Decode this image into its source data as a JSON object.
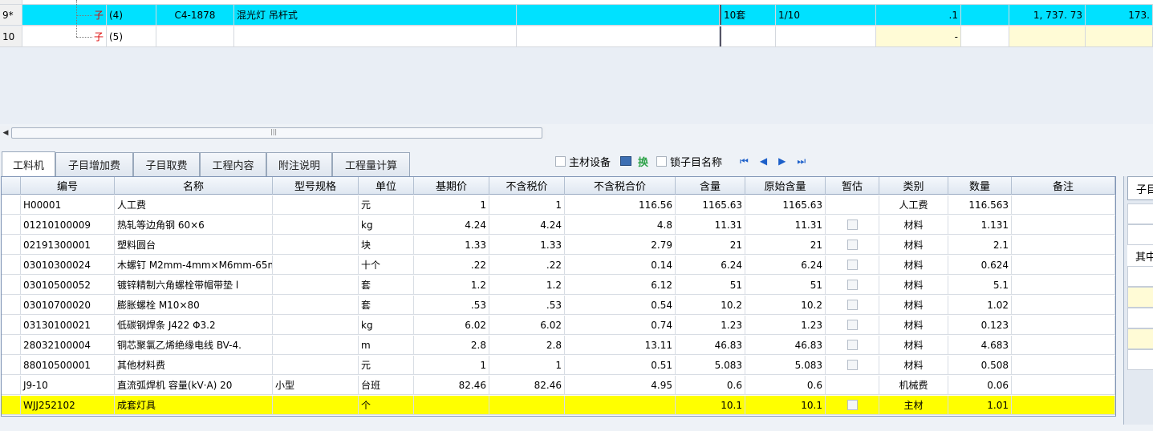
{
  "top": {
    "rows": [
      {
        "num": "9*",
        "type": "子",
        "code_seq": "(4)",
        "code": "C4-1878",
        "name": "混光灯 吊杆式",
        "unit": "10套",
        "qty": "1/10",
        "amt": ".1",
        "price": "1, 737. 73",
        "total": "173."
      },
      {
        "num": "10",
        "type": "子",
        "code_seq": "(5)",
        "code": "",
        "name": "",
        "unit": "",
        "qty": "",
        "amt": "-",
        "price": "",
        "total": ""
      }
    ]
  },
  "scroll": {
    "left_arrow": "◀",
    "grip": "|||"
  },
  "tabs": [
    "工料机",
    "子目增加费",
    "子目取费",
    "工程内容",
    "附注说明",
    "工程量计算"
  ],
  "tools": {
    "main_equipment": "主材设备",
    "swap": "换",
    "lock_name": "锁子目名称"
  },
  "grid": {
    "headers": [
      "编号",
      "名称",
      "型号规格",
      "单位",
      "基期价",
      "不含税价",
      "不含税合价",
      "含量",
      "原始含量",
      "暂估",
      "类别",
      "数量",
      "备注"
    ],
    "rows": [
      {
        "code": "H00001",
        "name": "人工费",
        "spec": "",
        "unit": "元",
        "base": "1",
        "notax": "1",
        "total": "116.56",
        "content": "1165.63",
        "orig": "1165.63",
        "est": false,
        "cat": "人工费",
        "qty": "116.563",
        "note": ""
      },
      {
        "code": "01210100009",
        "name": "热轧等边角钢 60×6",
        "spec": "",
        "unit": "kg",
        "base": "4.24",
        "notax": "4.24",
        "total": "4.8",
        "content": "11.31",
        "orig": "11.31",
        "est": true,
        "cat": "材料",
        "qty": "1.131",
        "note": ""
      },
      {
        "code": "02191300001",
        "name": "塑料圆台",
        "spec": "",
        "unit": "块",
        "base": "1.33",
        "notax": "1.33",
        "total": "2.79",
        "content": "21",
        "orig": "21",
        "est": true,
        "cat": "材料",
        "qty": "2.1",
        "note": ""
      },
      {
        "code": "03010300024",
        "name": "木螺钉 M2mm-4mm×M6mm-65mr",
        "spec": "",
        "unit": "十个",
        "base": ".22",
        "notax": ".22",
        "total": "0.14",
        "content": "6.24",
        "orig": "6.24",
        "est": true,
        "cat": "材料",
        "qty": "0.624",
        "note": ""
      },
      {
        "code": "03010500052",
        "name": "镀锌精制六角螺栓带帽带垫 l",
        "spec": "",
        "unit": "套",
        "base": "1.2",
        "notax": "1.2",
        "total": "6.12",
        "content": "51",
        "orig": "51",
        "est": true,
        "cat": "材料",
        "qty": "5.1",
        "note": ""
      },
      {
        "code": "03010700020",
        "name": "膨胀螺栓 M10×80",
        "spec": "",
        "unit": "套",
        "base": ".53",
        "notax": ".53",
        "total": "0.54",
        "content": "10.2",
        "orig": "10.2",
        "est": true,
        "cat": "材料",
        "qty": "1.02",
        "note": ""
      },
      {
        "code": "03130100021",
        "name": "低碳钢焊条 J422 Φ3.2",
        "spec": "",
        "unit": "kg",
        "base": "6.02",
        "notax": "6.02",
        "total": "0.74",
        "content": "1.23",
        "orig": "1.23",
        "est": true,
        "cat": "材料",
        "qty": "0.123",
        "note": ""
      },
      {
        "code": "28032100004",
        "name": "铜芯聚氯乙烯绝缘电线 BV-4.",
        "spec": "",
        "unit": "m",
        "base": "2.8",
        "notax": "2.8",
        "total": "13.11",
        "content": "46.83",
        "orig": "46.83",
        "est": true,
        "cat": "材料",
        "qty": "4.683",
        "note": ""
      },
      {
        "code": "88010500001",
        "name": "其他材料费",
        "spec": "",
        "unit": "元",
        "base": "1",
        "notax": "1",
        "total": "0.51",
        "content": "5.083",
        "orig": "5.083",
        "est": true,
        "cat": "材料",
        "qty": "0.508",
        "note": ""
      },
      {
        "code": "J9-10",
        "name": "直流弧焊机 容量(kV·A) 20",
        "spec": "小型",
        "unit": "台班",
        "base": "82.46",
        "notax": "82.46",
        "total": "4.95",
        "content": "0.6",
        "orig": "0.6",
        "est": false,
        "cat": "机械费",
        "qty": "0.06",
        "note": ""
      },
      {
        "code": "WJJ252102",
        "name": "成套灯具",
        "spec": "",
        "unit": "个",
        "base": "",
        "notax": "",
        "total": "",
        "content": "10.1",
        "orig": "10.1",
        "est": true,
        "cat": "主材",
        "qty": "1.01",
        "note": ""
      }
    ]
  },
  "side": {
    "tab": "子目",
    "label": "其中"
  }
}
